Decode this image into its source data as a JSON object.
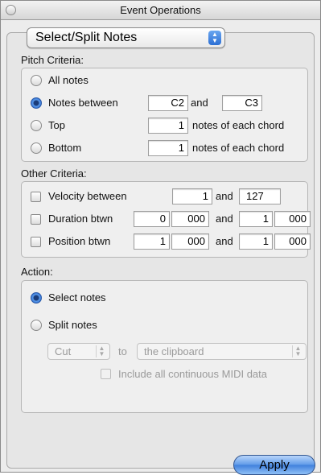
{
  "window": {
    "title": "Event Operations"
  },
  "mode_popup": {
    "value": "Select/Split Notes"
  },
  "pitch": {
    "label": "Pitch Criteria:",
    "all_notes": "All notes",
    "notes_between": "Notes between",
    "low": "C2",
    "and": "and",
    "high": "C3",
    "top": "Top",
    "top_value": "1",
    "bottom": "Bottom",
    "bottom_value": "1",
    "of_each_chord": "notes of each chord",
    "selected": "notes_between"
  },
  "other": {
    "label": "Other Criteria:",
    "velocity": {
      "label": "Velocity between",
      "min": "1",
      "and": "and",
      "max": "127"
    },
    "duration": {
      "label": "Duration btwn",
      "a1": "0",
      "a2": "000",
      "and": "and",
      "b1": "1",
      "b2": "000"
    },
    "position": {
      "label": "Position btwn",
      "a1": "1",
      "a2": "000",
      "and": "and",
      "b1": "1",
      "b2": "000"
    }
  },
  "action": {
    "label": "Action:",
    "select_notes": "Select notes",
    "split_notes": "Split notes",
    "selected": "select_notes",
    "cut": "Cut",
    "to": "to",
    "destination": "the clipboard",
    "include_midi": "Include all continuous MIDI data"
  },
  "apply_label": "Apply"
}
